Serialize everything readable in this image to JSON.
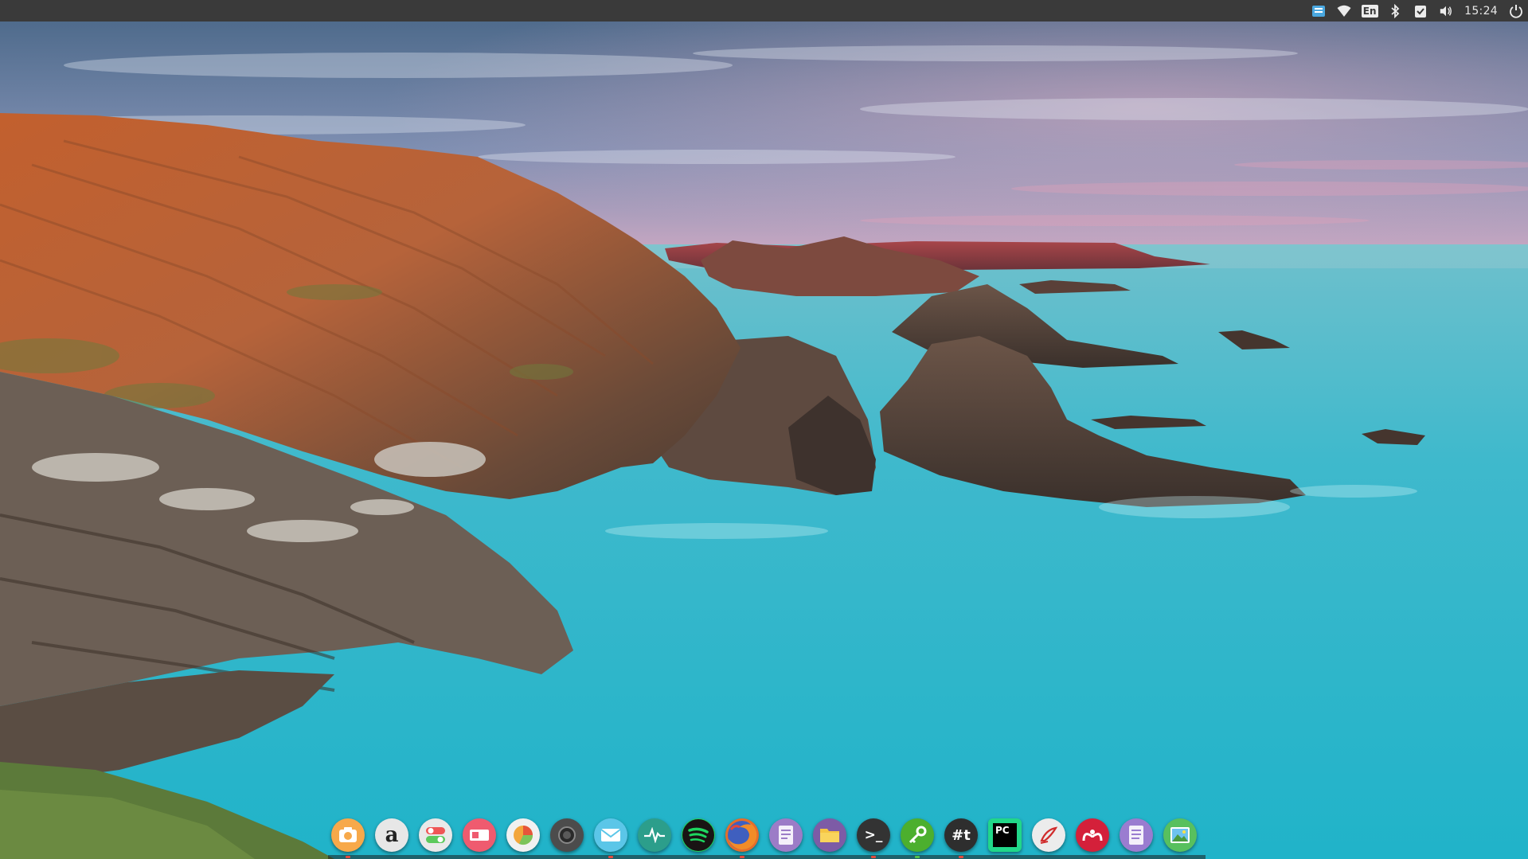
{
  "top_panel": {
    "clock": "15:24",
    "keyboard_layout": "En",
    "tray_icons": [
      "notification-app-icon",
      "wifi-icon",
      "keyboard-layout-icon",
      "bluetooth-icon",
      "clipboard-check-icon",
      "volume-icon",
      "power-icon"
    ]
  },
  "dock": {
    "apps": [
      {
        "icon": "screenshot-app-icon",
        "color": "#f7a94a"
      },
      {
        "icon": "amazon-icon",
        "label": "a",
        "color": "#e7e7e7"
      },
      {
        "icon": "toggle-settings-icon",
        "color": "#e9e9e9"
      },
      {
        "icon": "slides-app-icon",
        "color": "#ef5b6f"
      },
      {
        "icon": "disk-usage-icon",
        "color": "#f1f1f1"
      },
      {
        "icon": "camera-icon",
        "color": "#4c4c4c"
      },
      {
        "icon": "mail-icon",
        "color": "#5bc6e8"
      },
      {
        "icon": "system-monitor-icon",
        "color": "#2c9e8b"
      },
      {
        "icon": "spotify-icon",
        "color": "#1ed760"
      },
      {
        "icon": "firefox-icon",
        "color": "#e66d2a"
      },
      {
        "icon": "text-editor-icon",
        "color": "#9c7cc7"
      },
      {
        "icon": "files-icon",
        "color": "#7d5ba6"
      },
      {
        "icon": "terminal-icon",
        "label": ">_",
        "color": "#333333"
      },
      {
        "icon": "passwords-key-icon",
        "color": "#4caf2e"
      },
      {
        "icon": "hashtag-app-icon",
        "label": "#t",
        "color": "#2e2e2e"
      },
      {
        "icon": "pycharm-icon",
        "label": "PC",
        "color": "#21d789"
      },
      {
        "icon": "pen-app-icon",
        "color": "#ececec"
      },
      {
        "icon": "mendeley-icon",
        "color": "#d4203a"
      },
      {
        "icon": "document-viewer-icon",
        "color": "#9a7cd0"
      },
      {
        "icon": "image-viewer-icon",
        "color": "#58c05e"
      }
    ]
  }
}
